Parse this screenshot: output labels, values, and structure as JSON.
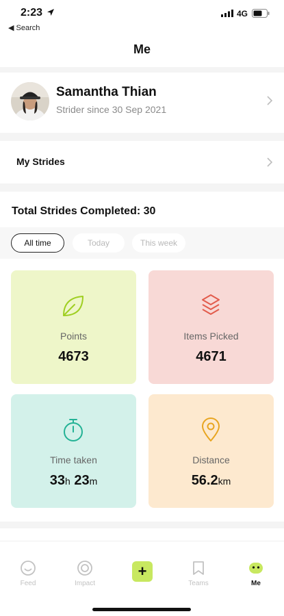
{
  "status_bar": {
    "time": "2:23",
    "back_label": "◀ Search",
    "network": "4G"
  },
  "header": {
    "title": "Me"
  },
  "profile": {
    "name": "Samantha Thian",
    "subtitle": "Strider since 30 Sep 2021"
  },
  "my_strides": {
    "label": "My Strides"
  },
  "summary": {
    "title": "Total Strides Completed: 30"
  },
  "filters": {
    "all_time": "All time",
    "today": "Today",
    "this_week": "This week",
    "selected": "All time"
  },
  "stats": {
    "points": {
      "label": "Points",
      "value": "4673"
    },
    "items": {
      "label": "Items Picked",
      "value": "4671"
    },
    "time": {
      "label": "Time taken",
      "hours": "33",
      "hours_unit": "h",
      "minutes": "23",
      "minutes_unit": "m"
    },
    "distance": {
      "label": "Distance",
      "value": "56.2",
      "unit": "km"
    }
  },
  "tabs": {
    "feed": "Feed",
    "impact": "Impact",
    "teams": "Teams",
    "me": "Me",
    "active": "Me"
  },
  "colors": {
    "accent": "#c8e860",
    "points_bg": "#eef6c9",
    "items_bg": "#f8d9d6",
    "time_bg": "#d3f1ea",
    "distance_bg": "#fde9cf"
  },
  "icons": [
    "location-arrow-icon",
    "signal-icon",
    "battery-icon",
    "chevron-right-icon",
    "leaf-icon",
    "layers-icon",
    "stopwatch-icon",
    "map-pin-icon",
    "smile-icon",
    "target-icon",
    "plus-icon",
    "bookmark-icon",
    "mascot-icon"
  ]
}
